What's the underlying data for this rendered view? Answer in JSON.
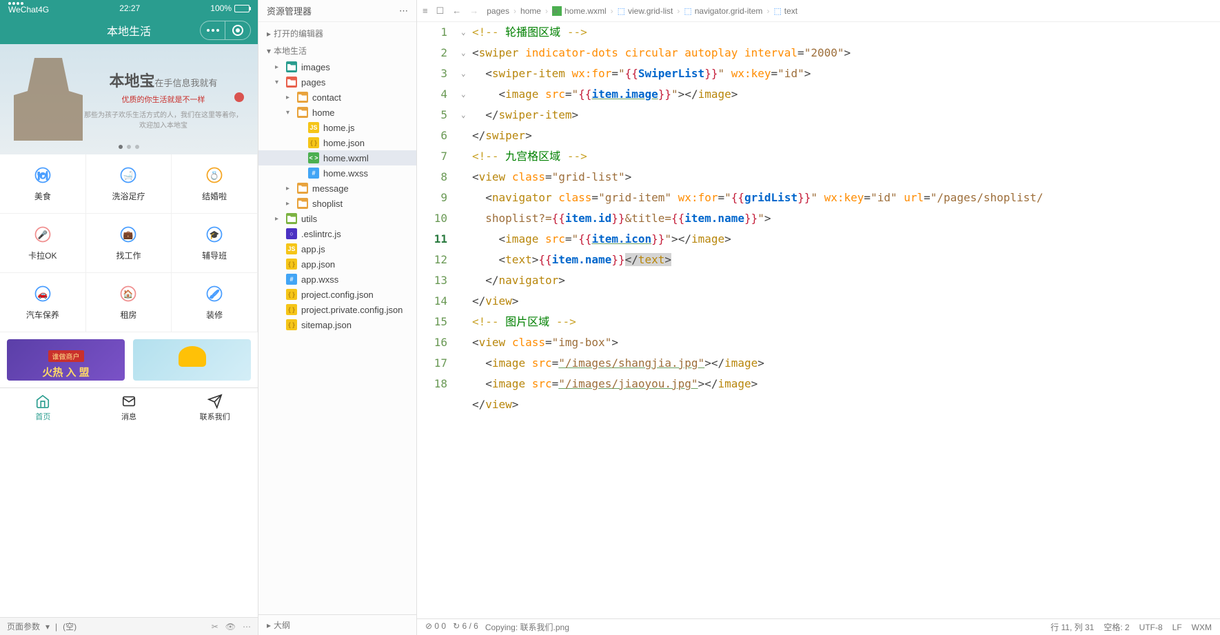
{
  "simulator": {
    "carrier": "WeChat4G",
    "time": "22:27",
    "battery": "100%",
    "title": "本地生活",
    "swiper": {
      "title_main": "本地宝",
      "title_sub": "在手信息我就有",
      "subtitle": "优质的你生活就是不一样",
      "desc": "那些为孩子欢乐生活方式的人，我们在这里等着你，欢迎加入本地宝"
    },
    "grid": [
      {
        "label": "美食",
        "color": "#4a9eff"
      },
      {
        "label": "洗浴足疗",
        "color": "#4a9eff"
      },
      {
        "label": "结婚啦",
        "color": "#f5a623"
      },
      {
        "label": "卡拉OK",
        "color": "#f08f8f"
      },
      {
        "label": "找工作",
        "color": "#4a9eff"
      },
      {
        "label": "辅导班",
        "color": "#4a9eff"
      },
      {
        "label": "汽车保养",
        "color": "#4a9eff"
      },
      {
        "label": "租房",
        "color": "#f08f8f"
      },
      {
        "label": "装修",
        "color": "#4a9eff"
      }
    ],
    "imgbox": {
      "img1_badge": "谁做商户",
      "img1_text": "火热 入 盟"
    },
    "tabbar": [
      {
        "label": "首页",
        "active": true
      },
      {
        "label": "消息",
        "active": false
      },
      {
        "label": "联系我们",
        "active": false
      }
    ],
    "footer_label": "页面参数",
    "footer_value": "(空)"
  },
  "explorer": {
    "title": "资源管理器",
    "sections": {
      "open_editors": "打开的编辑器",
      "project": "本地生活",
      "outline": "大纲"
    },
    "tree": [
      {
        "label": "images",
        "depth": 1,
        "type": "folder-img",
        "chev": "▸"
      },
      {
        "label": "pages",
        "depth": 1,
        "type": "folder-pages",
        "chev": "▾"
      },
      {
        "label": "contact",
        "depth": 2,
        "type": "folder",
        "chev": "▸"
      },
      {
        "label": "home",
        "depth": 2,
        "type": "folder",
        "chev": "▾"
      },
      {
        "label": "home.js",
        "depth": 3,
        "type": "js",
        "chev": ""
      },
      {
        "label": "home.json",
        "depth": 3,
        "type": "json",
        "chev": ""
      },
      {
        "label": "home.wxml",
        "depth": 3,
        "type": "wxml",
        "chev": "",
        "selected": true
      },
      {
        "label": "home.wxss",
        "depth": 3,
        "type": "wxss",
        "chev": ""
      },
      {
        "label": "message",
        "depth": 2,
        "type": "folder",
        "chev": "▸"
      },
      {
        "label": "shoplist",
        "depth": 2,
        "type": "folder",
        "chev": "▸"
      },
      {
        "label": "utils",
        "depth": 1,
        "type": "folder-utils",
        "chev": "▸"
      },
      {
        "label": ".eslintrc.js",
        "depth": 1,
        "type": "eslint",
        "chev": ""
      },
      {
        "label": "app.js",
        "depth": 1,
        "type": "js",
        "chev": ""
      },
      {
        "label": "app.json",
        "depth": 1,
        "type": "json",
        "chev": ""
      },
      {
        "label": "app.wxss",
        "depth": 1,
        "type": "wxss",
        "chev": ""
      },
      {
        "label": "project.config.json",
        "depth": 1,
        "type": "json",
        "chev": ""
      },
      {
        "label": "project.private.config.json",
        "depth": 1,
        "type": "json",
        "chev": ""
      },
      {
        "label": "sitemap.json",
        "depth": 1,
        "type": "json",
        "chev": ""
      }
    ]
  },
  "breadcrumb": [
    "pages",
    "home",
    "home.wxml",
    "view.grid-list",
    "navigator.grid-item",
    "text"
  ],
  "statusbar": {
    "center": {
      "warn_err": "0  0",
      "progress": "6 / 6",
      "copy": "Copying: 联系我们.png"
    },
    "right": {
      "pos": "行 11, 列 31",
      "spaces": "空格: 2",
      "encoding": "UTF-8",
      "eol": "LF",
      "lang": "WXM"
    }
  },
  "code_data": {
    "c1": "轮播图区域",
    "c2": "九宫格区域",
    "c3": "图片区域",
    "interval": "\"2000\"",
    "for1": "SwiperList",
    "key1": "\"id\"",
    "img1": "item.image",
    "cls1": "\"grid-list\"",
    "cls2": "\"grid-item\"",
    "for2": "gridList",
    "key2": "\"id\"",
    "url": "\"/pages/shoplist/",
    "url2a": "shoplist?=",
    "url2b": "item.id",
    "url2c": "&title=",
    "url2d": "item.name",
    "url2e": "\"",
    "icon": "item.icon",
    "name": "item.name",
    "cls3": "\"img-box\"",
    "src1": "\"/images/shangjia.jpg\"",
    "src2": "\"/images/jiaoyou.jpg\""
  }
}
